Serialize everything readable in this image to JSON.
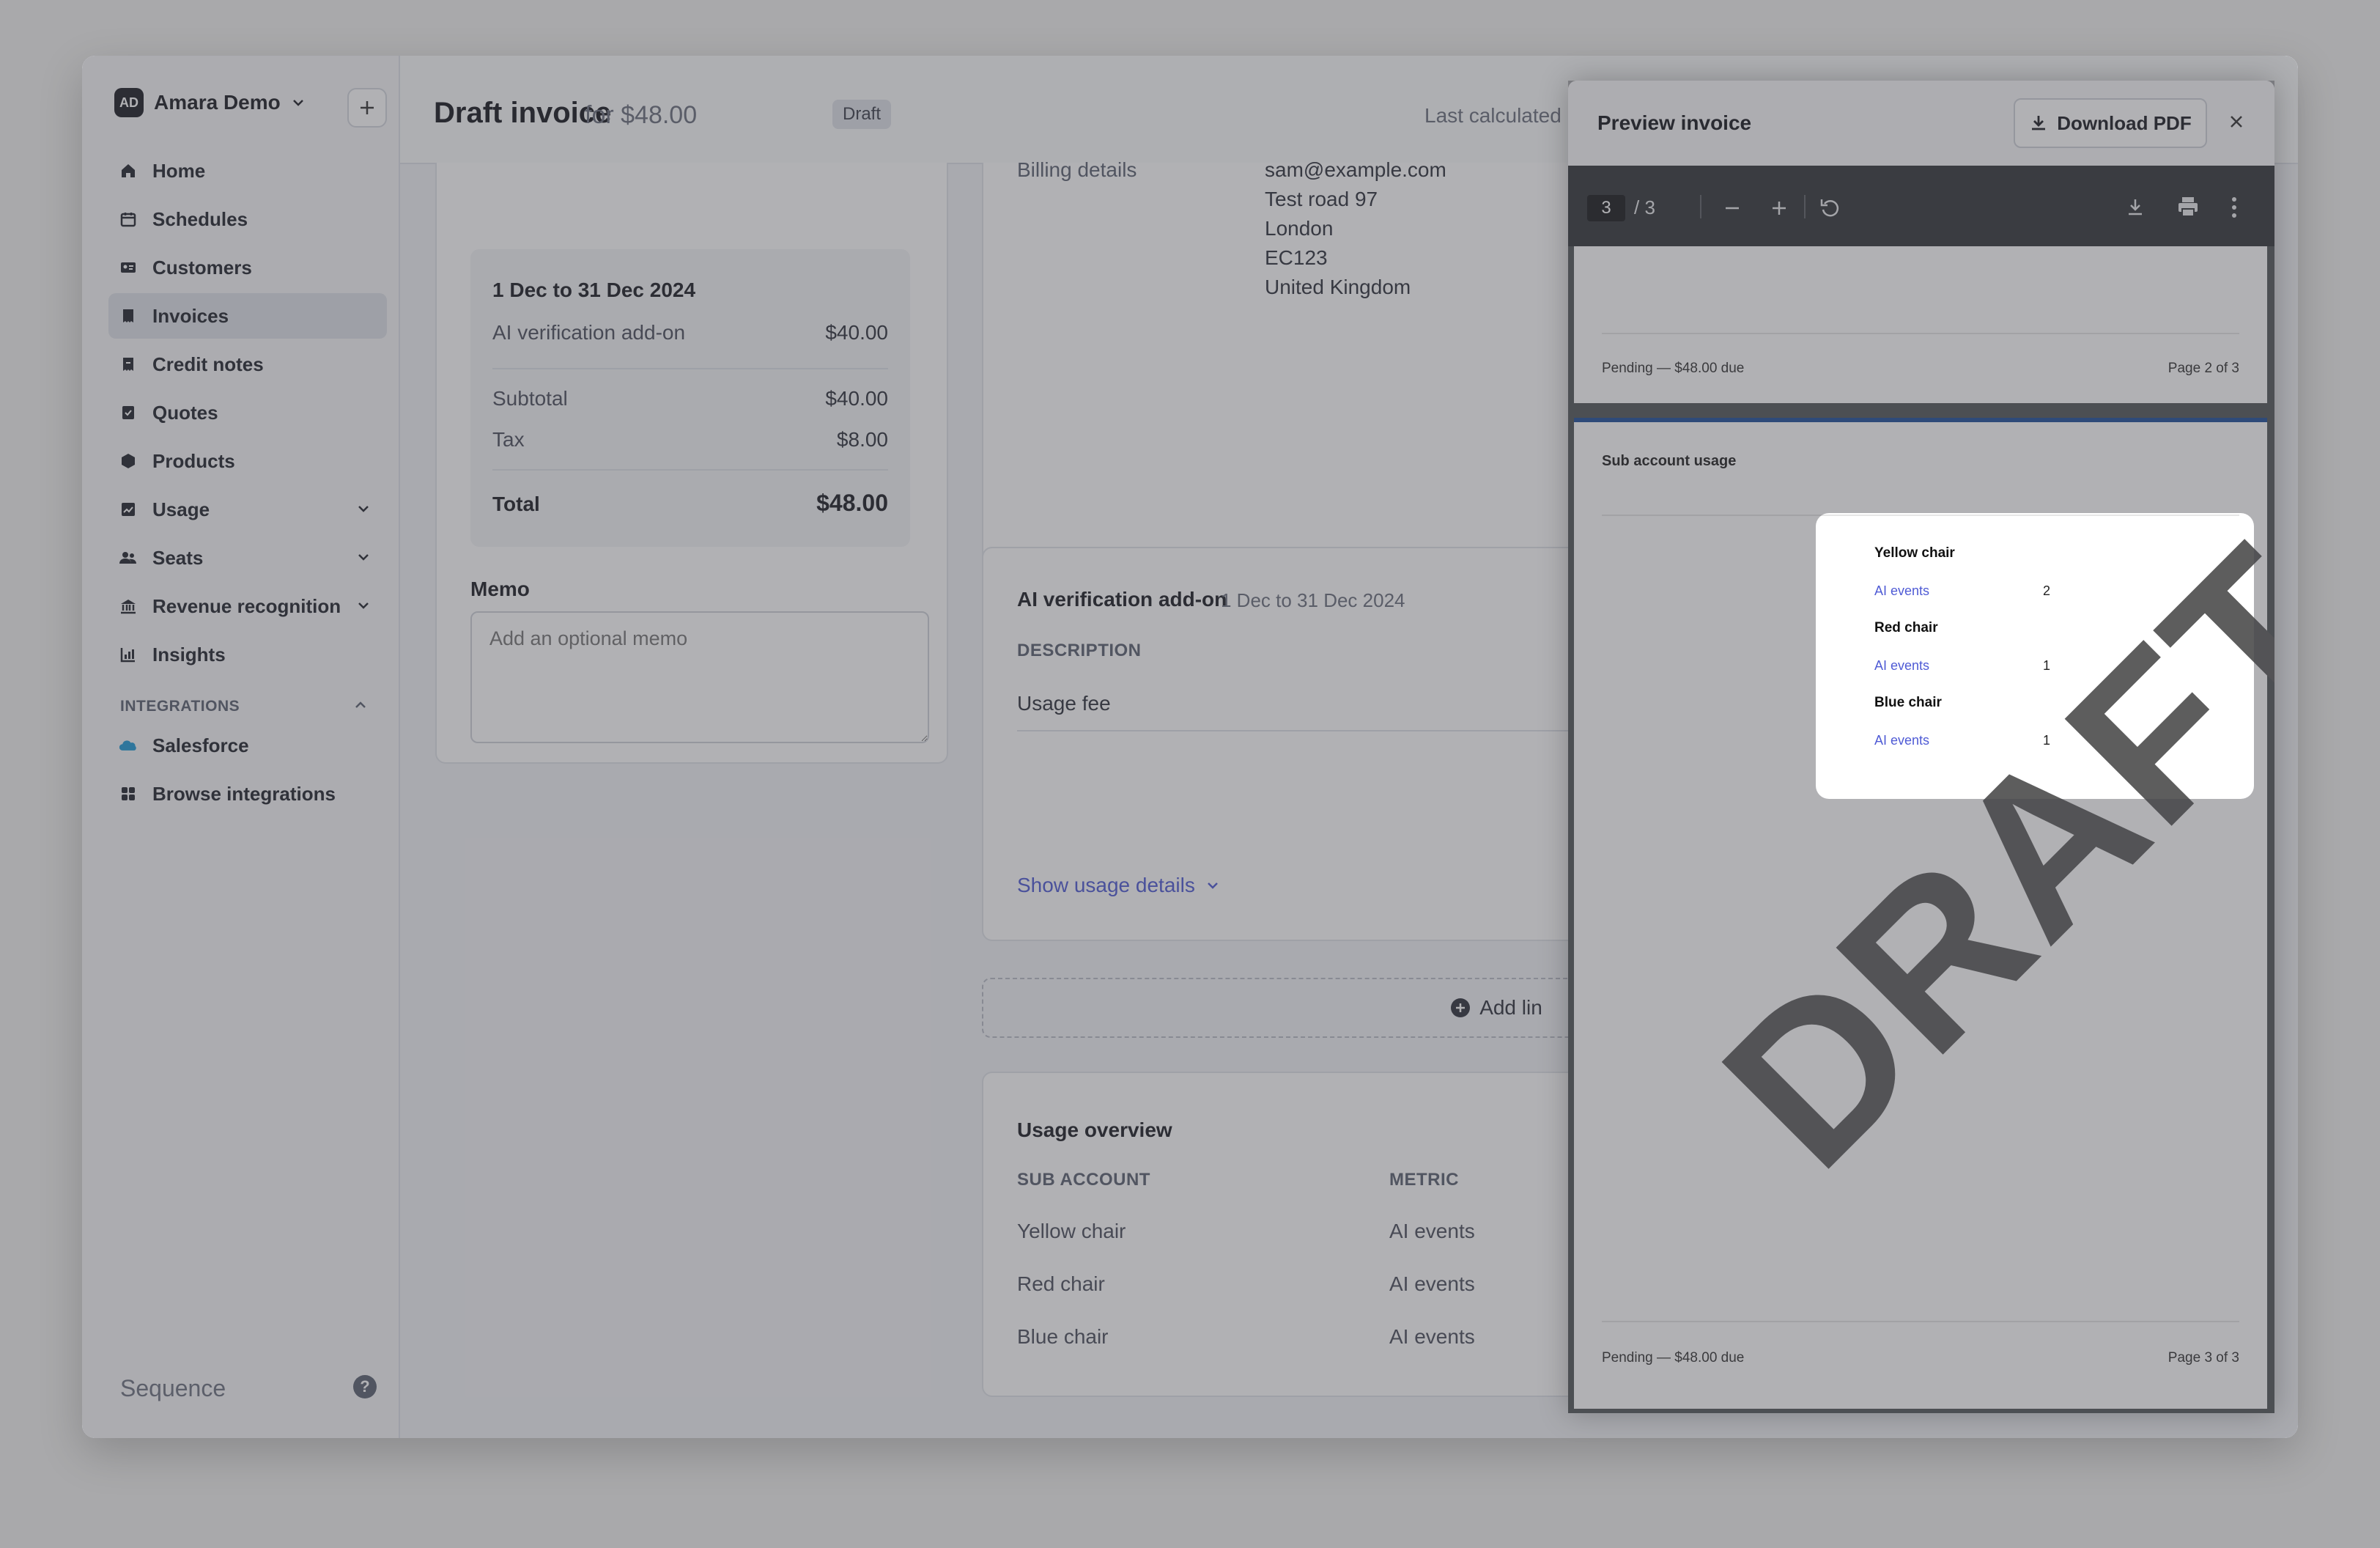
{
  "workspace": {
    "initials": "AD",
    "name": "Amara Demo"
  },
  "sidebar": {
    "items": [
      {
        "label": "Home"
      },
      {
        "label": "Schedules"
      },
      {
        "label": "Customers"
      },
      {
        "label": "Invoices"
      },
      {
        "label": "Credit notes"
      },
      {
        "label": "Quotes"
      },
      {
        "label": "Products"
      },
      {
        "label": "Usage"
      },
      {
        "label": "Seats"
      },
      {
        "label": "Revenue recognition"
      },
      {
        "label": "Insights"
      }
    ],
    "integrations_heading": "INTEGRATIONS",
    "integrations": [
      {
        "label": "Salesforce"
      },
      {
        "label": "Browse integrations"
      }
    ],
    "brand": "Sequence",
    "help": "?"
  },
  "header": {
    "title": "Draft invoice",
    "amount": "for $48.00",
    "status_badge": "Draft",
    "last_calculated": "Last calculated"
  },
  "summary": {
    "period": "1 Dec to 31 Dec 2024",
    "line_label": "AI verification add-on",
    "line_value": "$40.00",
    "subtotal_label": "Subtotal",
    "subtotal_value": "$40.00",
    "tax_label": "Tax",
    "tax_value": "$8.00",
    "total_label": "Total",
    "total_value": "$48.00"
  },
  "memo": {
    "label": "Memo",
    "placeholder": "Add an optional memo"
  },
  "billing": {
    "label": "Billing details",
    "email": "sam@example.com",
    "address": [
      "Test road 97",
      "London",
      "EC123",
      "United Kingdom"
    ]
  },
  "line_item": {
    "title": "AI verification add-on",
    "period": "1 Dec to 31 Dec 2024",
    "description_header": "DESCRIPTION",
    "description": "Usage fee",
    "show_details": "Show usage details"
  },
  "add_line": {
    "label": "Add lin"
  },
  "usage_overview": {
    "title": "Usage overview",
    "col_sub_account": "SUB ACCOUNT",
    "col_metric": "METRIC",
    "rows": [
      {
        "sub_account": "Yellow chair",
        "metric": "AI events"
      },
      {
        "sub_account": "Red chair",
        "metric": "AI events"
      },
      {
        "sub_account": "Blue chair",
        "metric": "AI events"
      }
    ]
  },
  "preview": {
    "title": "Preview invoice",
    "download_label": "Download PDF",
    "toolbar": {
      "page": "3",
      "total": "/  3"
    },
    "page2_footer_left": "Pending — $48.00 due",
    "page2_footer_right": "Page 2 of 3",
    "page3_heading": "Sub account usage",
    "usage": [
      {
        "name": "Yellow chair",
        "metric": "AI events",
        "value": "2"
      },
      {
        "name": "Red chair",
        "metric": "AI events",
        "value": "1"
      },
      {
        "name": "Blue chair",
        "metric": "AI events",
        "value": "1"
      }
    ],
    "watermark": "DRAFT",
    "page3_footer_left": "Pending — $48.00 due",
    "page3_footer_right": "Page 3 of 3"
  },
  "colors": {
    "accent": "#4f5bd5",
    "overlay": "#a9a9ab",
    "pdf_toolbar": "#323639"
  }
}
